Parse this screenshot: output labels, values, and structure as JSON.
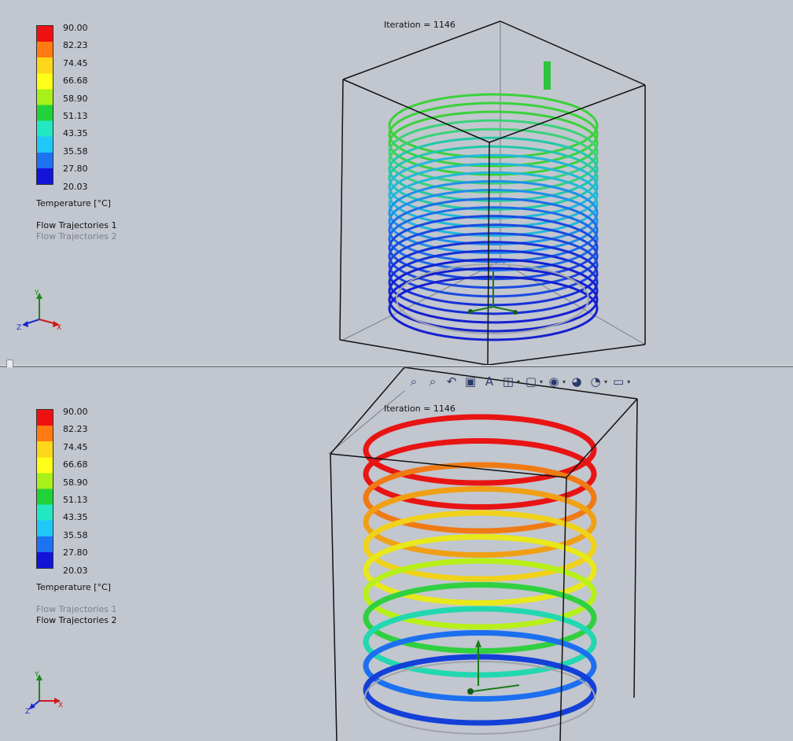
{
  "top_view": {
    "iteration": "Iteration = 1146",
    "legend": {
      "ticks": [
        "90.00",
        "82.23",
        "74.45",
        "66.68",
        "58.90",
        "51.13",
        "43.35",
        "35.58",
        "27.80",
        "20.03"
      ],
      "colors": [
        "#ee1111",
        "#ff7a12",
        "#ffd71a",
        "#ffff1a",
        "#a8f01a",
        "#22d23a",
        "#22e8c4",
        "#1ec8f8",
        "#1c72f0",
        "#1414d8"
      ],
      "title": "Temperature [°C]"
    },
    "trajectories": [
      "Flow Trajectories 1",
      "Flow Trajectories 2"
    ],
    "active_trajectory": "Flow Trajectories 1",
    "triad": {
      "y": "Y",
      "x": "X",
      "z": "Z"
    }
  },
  "bottom_view": {
    "iteration": "Iteration = 1146",
    "legend": {
      "ticks": [
        "90.00",
        "82.23",
        "74.45",
        "66.68",
        "58.90",
        "51.13",
        "43.35",
        "35.58",
        "27.80",
        "20.03"
      ],
      "colors": [
        "#ee1111",
        "#ff7a12",
        "#ffd71a",
        "#ffff1a",
        "#a8f01a",
        "#22d23a",
        "#22e8c4",
        "#1ec8f8",
        "#1c72f0",
        "#1414d8"
      ],
      "title": "Temperature [°C]"
    },
    "trajectories": [
      "Flow Trajectories 1",
      "Flow Trajectories 2"
    ],
    "active_trajectory": "Flow Trajectories 2",
    "triad": {
      "y": "Y",
      "x": "X",
      "z": "Z"
    },
    "toolbar": [
      "zoom-to-fit-icon",
      "zoom-area-icon",
      "previous-view-icon",
      "section-view-icon",
      "dynamic-annotation-icon",
      "view-orientation-icon",
      "display-style-icon",
      "hide-show-items-icon",
      "edit-appearance-icon",
      "apply-scene-icon",
      "view-settings-icon"
    ]
  }
}
